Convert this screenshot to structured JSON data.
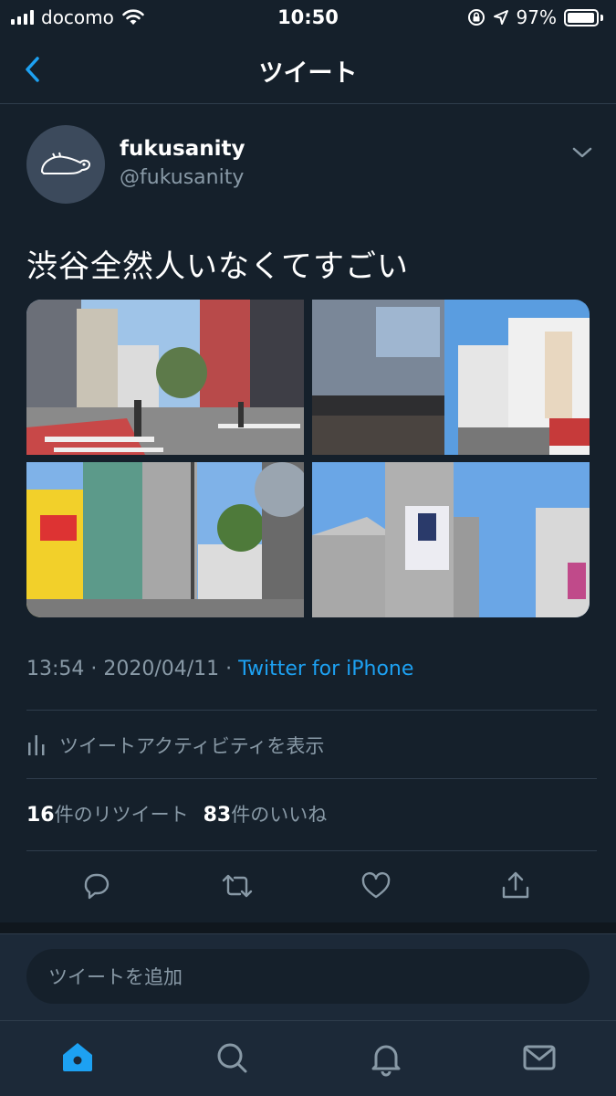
{
  "status_bar": {
    "carrier": "docomo",
    "time": "10:50",
    "battery": "97%",
    "battery_level": 0.97
  },
  "header": {
    "title": "ツイート",
    "back_icon": "chevron-left-icon"
  },
  "tweet": {
    "display_name": "fukusanity",
    "handle": "@fukusanity",
    "text": "渋谷全然人いなくてすごい",
    "timestamp": "13:54 · 2020/04/11 · ",
    "source": "Twitter for iPhone",
    "activity_label": "ツイートアクティビティを表示",
    "retweet_count": "16",
    "retweet_label": "件のリツイート",
    "like_count": "83",
    "like_label": "件のいいね",
    "photos": [
      {
        "name": "photo-shibuya-crossing"
      },
      {
        "name": "photo-shibuya-station-building"
      },
      {
        "name": "photo-shibuya-street-buildings"
      },
      {
        "name": "photo-shibuya-109-tower"
      }
    ]
  },
  "actions": [
    "reply-icon",
    "retweet-icon",
    "like-icon",
    "share-icon"
  ],
  "reply": {
    "placeholder": "ツイートを追加"
  },
  "tab_bar": [
    "home-icon",
    "search-icon",
    "notifications-icon",
    "messages-icon"
  ],
  "colors": {
    "background": "#15202b",
    "accent": "#1da1f2",
    "secondary_text": "#8899a6",
    "divider": "#2f3d4c"
  }
}
